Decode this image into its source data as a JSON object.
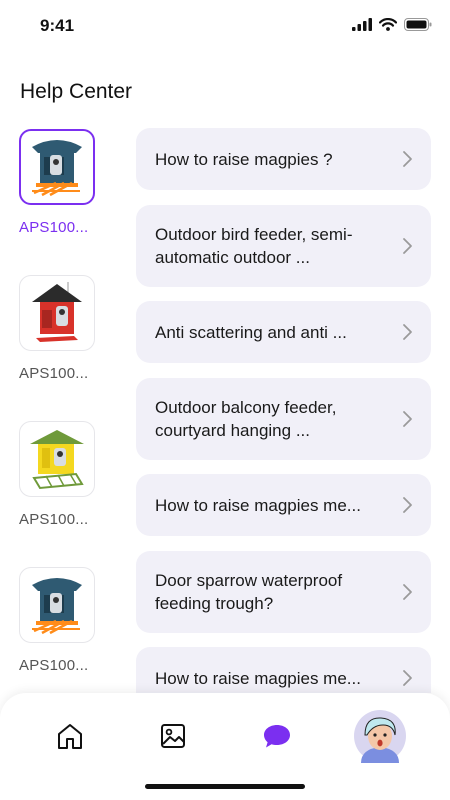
{
  "status_bar": {
    "time": "9:41"
  },
  "header": {
    "title": "Help Center"
  },
  "products": [
    {
      "label": "APS100...",
      "selected": true,
      "roof_color": "#2f5a72"
    },
    {
      "label": "APS100...",
      "selected": false,
      "roof_color": "#2b2b2b"
    },
    {
      "label": "APS100...",
      "selected": false,
      "roof_color": "#6f9a3a"
    },
    {
      "label": "APS100...",
      "selected": false,
      "roof_color": "#2f5a72"
    }
  ],
  "faq": [
    "How to raise magpies ?",
    "Outdoor bird feeder, semi-automatic outdoor ...",
    "Anti scattering and anti ...",
    "Outdoor balcony feeder, courtyard hanging ...",
    "How to raise magpies me...",
    "Door sparrow waterproof feeding trough?",
    "How to raise magpies me..."
  ],
  "tabs": [
    {
      "name": "home",
      "icon": "home-icon"
    },
    {
      "name": "gallery",
      "icon": "image-icon"
    },
    {
      "name": "help",
      "icon": "chat-bubble-icon",
      "active": true
    },
    {
      "name": "profile",
      "icon": "avatar"
    }
  ],
  "colors": {
    "accent": "#7b2ff0",
    "card_bg": "#f1f0f8",
    "label_gray": "#555555"
  }
}
